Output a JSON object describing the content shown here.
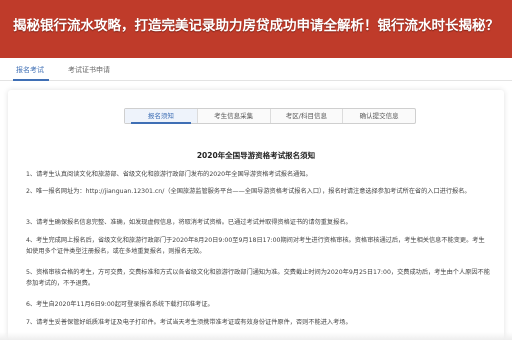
{
  "banner": {
    "title": "揭秘银行流水攻略，打造完美记录助力房贷成功申请全解析！银行流水时长揭秘？"
  },
  "top_tabs": [
    {
      "label": "报名考试"
    },
    {
      "label": "考试证书申请"
    }
  ],
  "steps": [
    {
      "label": "报名须知"
    },
    {
      "label": "考生信息采集"
    },
    {
      "label": "考区/科目信息"
    },
    {
      "label": "确认提交信息"
    }
  ],
  "notice": {
    "title": "2020年全国导游资格考试报名须知",
    "items": [
      "1、请考生认真阅读文化和旅游部、省级文化和旅游行政部门发布的2020年全国导游资格考试报名通知。",
      "2、唯一报名网址为：http://jianguan.12301.cn/（全国旅游监管服务平台——全国导游资格考试报名入口），报名时请注意选择参加考试所在省的入口进行报名。",
      "3、请考生确保报名信息完整、准确，如发现虚假信息，将取消考试资格。已通过考试并取得资格证书的请勿重复报名。",
      "4、考生完成网上报名后，省级文化和旅游行政部门于2020年8月20日9:00至9月18日17:00期间对考生进行资格审核。资格审核通过后，考生相关信息不能变更。考生如使用多个证件类型注册报名，或在多地重复报名，则报名无效。",
      "5、资格审核合格的考生，方可交费，交费标准和方式以各省级文化和旅游行政部门通知为准。交费截止时间为2020年9月25日17:00，交费成功后，考生由个人原因不能参加考试的，不予退费。",
      "6、考生自2020年11月6日9:00起可登录报名系统下载打印准考证。",
      "7、请考生妥善保管好纸质准考证及电子打印件。考试当天考生须携带准考证或有效身份证件原件，否则不能进入考场。"
    ]
  },
  "colors": {
    "banner": "#bf3b2a",
    "accent": "#3f6fb5"
  }
}
